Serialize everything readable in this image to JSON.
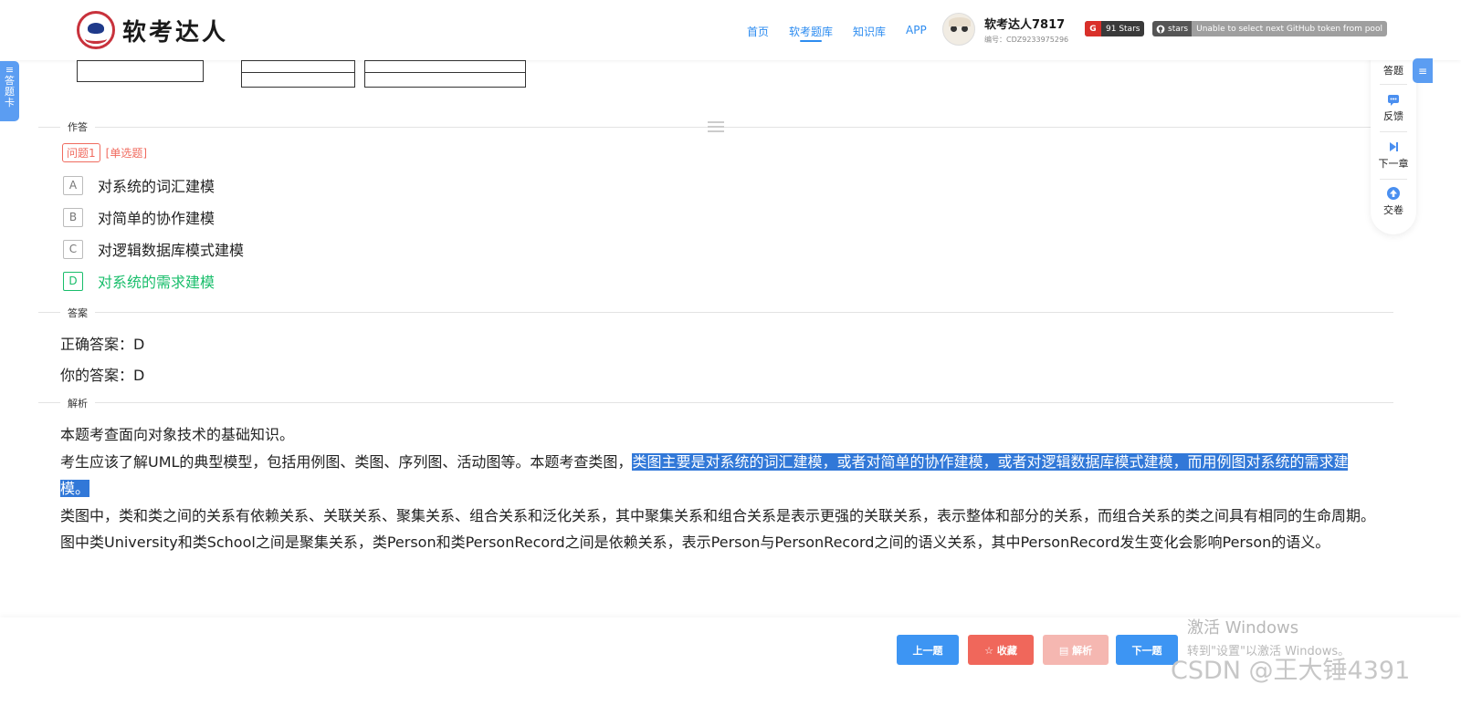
{
  "header": {
    "logo_text": "软考达人",
    "nav": [
      {
        "label": "首页"
      },
      {
        "label": "软考题库"
      },
      {
        "label": "知识库"
      },
      {
        "label": "APP"
      }
    ],
    "user_name": "软考达人7817",
    "user_id": "编号：CDZ9233975296",
    "badge_stars_icon": "G",
    "badge_stars_text": "91 Stars",
    "badge_gh_left": "stars",
    "badge_gh_right": "Unable to select next GitHub token from pool"
  },
  "left_tab": {
    "chars": [
      "答",
      "题",
      "卡"
    ]
  },
  "sections": {
    "answering": "作答",
    "answer": "答案",
    "analysis": "解析"
  },
  "question": {
    "number": "问题1",
    "type": "[单选题]",
    "options": [
      {
        "letter": "A",
        "text": "对系统的词汇建模"
      },
      {
        "letter": "B",
        "text": "对简单的协作建模"
      },
      {
        "letter": "C",
        "text": "对逻辑数据库模式建模"
      },
      {
        "letter": "D",
        "text": "对系统的需求建模"
      }
    ]
  },
  "answer": {
    "correct": "正确答案：D",
    "yours": "你的答案：D"
  },
  "analysis": {
    "p1": "本题考查面向对象技术的基础知识。",
    "p2_plain": "考生应该了解UML的典型模型，包括用例图、类图、序列图、活动图等。本题考查类图，",
    "p2_highlight": "类图主要是对系统的词汇建模，或者对简单的协作建模，或者对逻辑数据库模式建模，而用例图对系统的需求建模。",
    "p3": "类图中，类和类之间的关系有依赖关系、关联关系、聚集关系、组合关系和泛化关系，其中聚集关系和组合关系是表示更强的关联关系，表示整体和部分的关系，而组合关系的类之间具有相同的生命周期。图中类University和类School之间是聚集关系，类Person和类PersonRecord之间是依赖关系，表示Person与PersonRecord之间的语义关系，其中PersonRecord发生变化会影响Person的语义。"
  },
  "right_panel": {
    "tools": [
      {
        "label": "答题",
        "icon": "answer-sheet-icon"
      },
      {
        "label": "反馈",
        "icon": "chat-bubble-icon"
      },
      {
        "label": "下一章",
        "icon": "skip-next-icon"
      },
      {
        "label": "交卷",
        "icon": "upload-arrow-icon"
      }
    ],
    "tab_icon": "≡"
  },
  "bottom": {
    "prev": "上一题",
    "fav": "☆ 收藏",
    "analysis": "▤ 解析",
    "next": "下一题"
  },
  "watermark": {
    "line1": "激活 Windows",
    "line2": "转到\"设置\"以激活 Windows。",
    "csdn": "CSDN @王大锤4391"
  },
  "colors": {
    "accent": "#2d8cf0",
    "danger": "#f06b5f",
    "correct": "#19be6b",
    "highlight": "#3178d8"
  }
}
